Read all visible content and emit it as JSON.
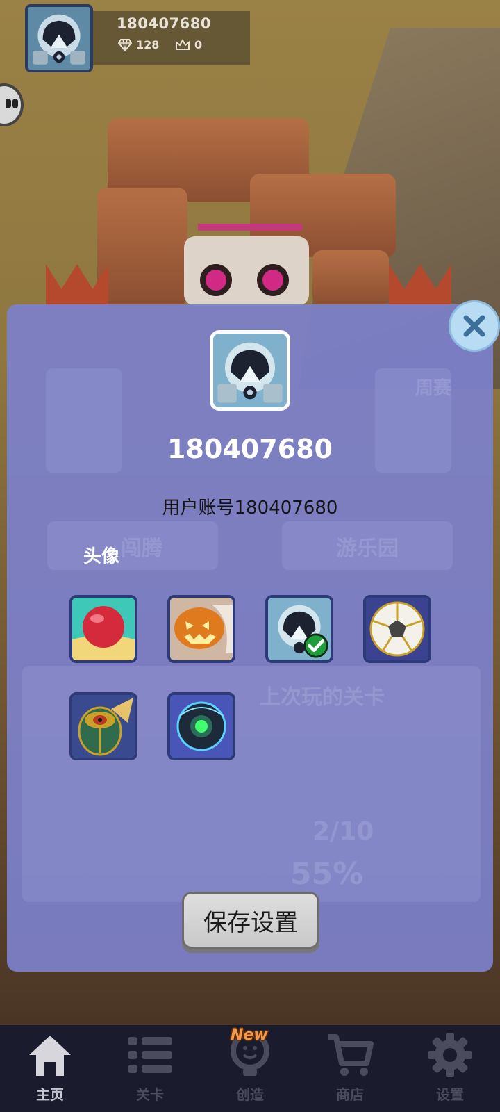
{
  "profile": {
    "name": "180407680",
    "gems": "128",
    "crowns": "0"
  },
  "modal": {
    "name": "180407680",
    "account": "用户账号180407680",
    "section_label": "头像",
    "save_label": "保存设置",
    "avatars": [
      {
        "name": "red-ball-avatar",
        "selected": false
      },
      {
        "name": "pumpkin-avatar",
        "selected": false
      },
      {
        "name": "astronaut-helmet-avatar",
        "selected": true
      },
      {
        "name": "soccer-ball-avatar",
        "selected": false
      },
      {
        "name": "scarab-eye-avatar",
        "selected": false
      },
      {
        "name": "cyber-orb-avatar",
        "selected": false
      }
    ]
  },
  "nav": {
    "items": [
      {
        "label": "主页",
        "icon": "home-icon",
        "active": true
      },
      {
        "label": "关卡",
        "icon": "list-icon",
        "active": false
      },
      {
        "label": "创造",
        "icon": "lightbulb-icon",
        "active": false,
        "badge": "New"
      },
      {
        "label": "商店",
        "icon": "cart-icon",
        "active": false
      },
      {
        "label": "设置",
        "icon": "gear-icon",
        "active": false
      }
    ]
  },
  "background_hints": {
    "left_button": "闯腾",
    "right_button": "游乐园",
    "weekly": "周赛",
    "last_level": "上次玩的关卡",
    "progress": "2/10",
    "percent": "55%"
  },
  "colors": {
    "modal_bg": "#7c80ca",
    "nav_bg": "#1b1b2e",
    "close_bg": "#b8dcf4",
    "new_badge": "#f2994a"
  }
}
